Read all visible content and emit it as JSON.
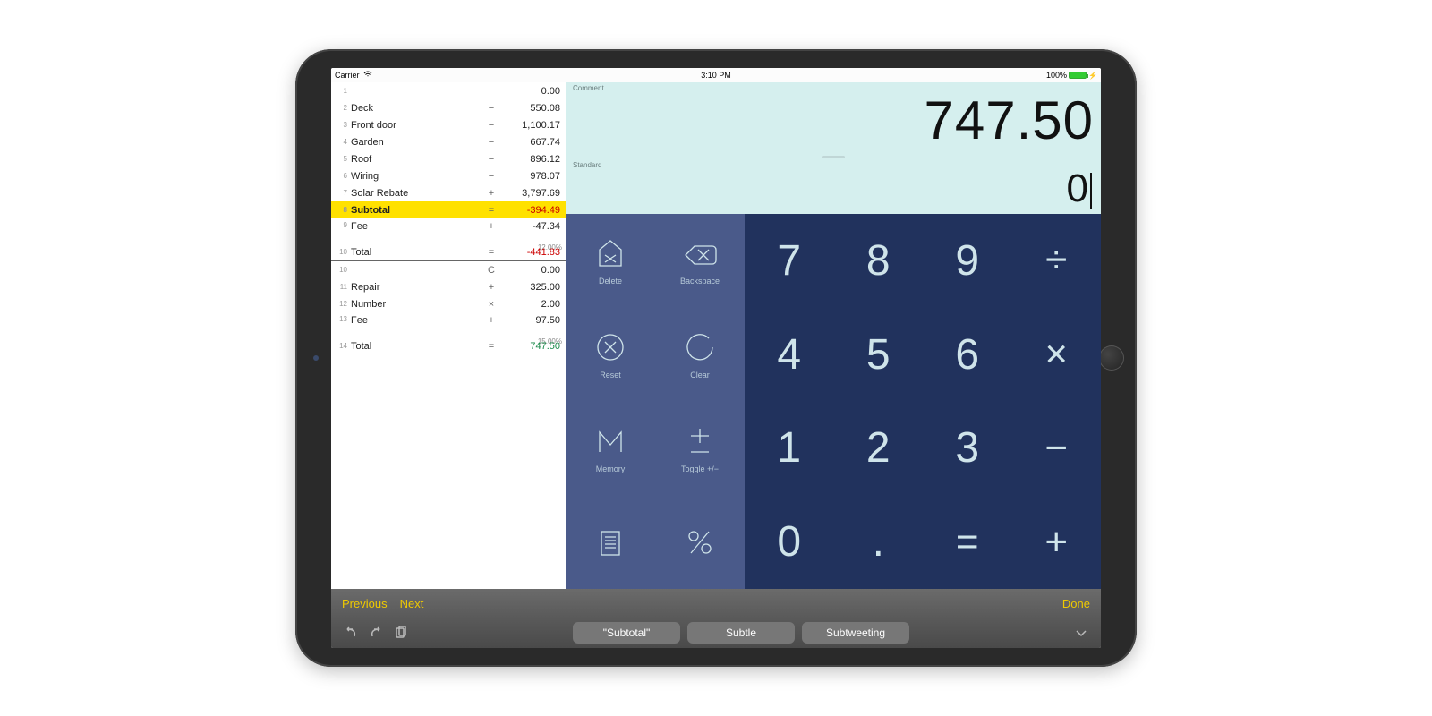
{
  "status": {
    "carrier": "Carrier",
    "time": "3:10 PM",
    "battery": "100%"
  },
  "ledger": {
    "group1": [
      {
        "idx": "1",
        "label": "",
        "op": "",
        "value": "0.00"
      },
      {
        "idx": "2",
        "label": "Deck",
        "op": "−",
        "value": "550.08"
      },
      {
        "idx": "3",
        "label": "Front door",
        "op": "−",
        "value": "1,100.17"
      },
      {
        "idx": "4",
        "label": "Garden",
        "op": "−",
        "value": "667.74"
      },
      {
        "idx": "5",
        "label": "Roof",
        "op": "−",
        "value": "896.12"
      },
      {
        "idx": "6",
        "label": "Wiring",
        "op": "−",
        "value": "978.07"
      },
      {
        "idx": "7",
        "label": "Solar Rebate",
        "op": "+",
        "value": "3,797.69"
      }
    ],
    "subtotal": {
      "idx": "8",
      "label": "Subtotal",
      "op": "=",
      "value": "-394.49"
    },
    "fee1": {
      "idx": "9",
      "label": "Fee",
      "op": "+",
      "value": "-47.34",
      "sub": "12.00%"
    },
    "total1": {
      "idx": "10",
      "label": "Total",
      "op": "=",
      "value": "-441.83"
    },
    "group2": [
      {
        "idx": "10",
        "label": "",
        "op": "C",
        "value": "0.00"
      },
      {
        "idx": "11",
        "label": "Repair",
        "op": "+",
        "value": "325.00"
      },
      {
        "idx": "12",
        "label": "Number",
        "op": "×",
        "value": "2.00"
      }
    ],
    "fee2": {
      "idx": "13",
      "label": "Fee",
      "op": "+",
      "value": "97.50",
      "sub": "15.00%"
    },
    "total2": {
      "idx": "14",
      "label": "Total",
      "op": "=",
      "value": "747.50"
    }
  },
  "display": {
    "comment_label": "Comment",
    "big": "747.50",
    "std_label": "Standard",
    "small": "0"
  },
  "funckeys": [
    {
      "name": "delete",
      "label": "Delete"
    },
    {
      "name": "backspace",
      "label": "Backspace"
    },
    {
      "name": "reset",
      "label": "Reset"
    },
    {
      "name": "clear",
      "label": "Clear"
    },
    {
      "name": "memory",
      "label": "Memory"
    },
    {
      "name": "toggle-sign",
      "label": "Toggle +/−"
    },
    {
      "name": "list",
      "label": ""
    },
    {
      "name": "percent",
      "label": ""
    }
  ],
  "numkeys": [
    "7",
    "8",
    "9",
    "÷",
    "4",
    "5",
    "6",
    "×",
    "1",
    "2",
    "3",
    "−",
    "0",
    ".",
    "=",
    "+"
  ],
  "toolbar1": {
    "previous": "Previous",
    "next": "Next",
    "done": "Done"
  },
  "toolbar2": {
    "suggestions": [
      "\"Subtotal\"",
      "Subtle",
      "Subtweeting"
    ]
  }
}
